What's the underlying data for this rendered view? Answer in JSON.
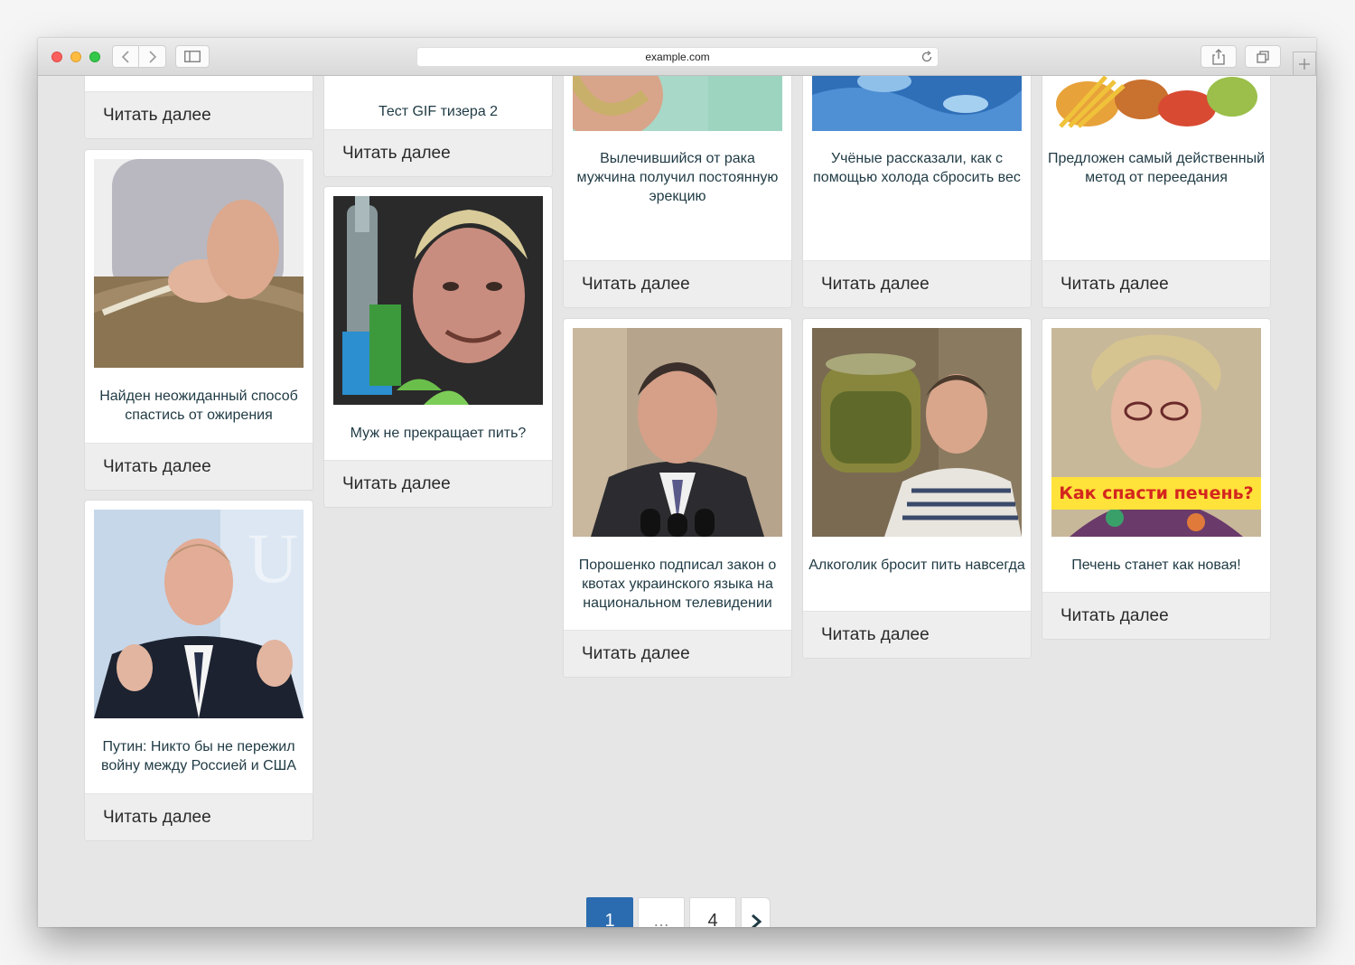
{
  "browser": {
    "url": "example.com"
  },
  "cards": {
    "c1": {
      "title": "",
      "more": "Читать далее"
    },
    "c2": {
      "title": "Найден неожиданный способ спастись от ожирения",
      "more": "Читать далее"
    },
    "c3": {
      "title": "Путин: Никто бы не пережил войну между Россией и США",
      "more": "Читать далее"
    },
    "c4": {
      "title": "Тест GIF тизера 2",
      "more": "Читать далее"
    },
    "c5": {
      "title": "Муж не прекращает пить?",
      "more": "Читать далее"
    },
    "c6": {
      "title": "Вылечившийся от рака мужчина получил постоянную эрекцию",
      "more": "Читать далее"
    },
    "c7": {
      "title": "Порошенко подписал закон о квотах украинского языка на национальном телевидении",
      "more": "Читать далее"
    },
    "c8": {
      "title": "Учёные рассказали, как с помощью холода сбросить вес",
      "more": "Читать далее"
    },
    "c9": {
      "title": "Алкоголик бросит пить навсегда",
      "more": "Читать далее"
    },
    "c10": {
      "title": "Предложен самый действенный метод от переедания",
      "more": "Читать далее"
    },
    "c11": {
      "title": "Печень станет как новая!",
      "more": "Читать далее",
      "banner": "Как спасти печень?"
    }
  },
  "pagination": {
    "current": "1",
    "ellipsis": "…",
    "last": "4",
    "next_icon": "chevron-right-icon"
  },
  "colors": {
    "accent": "#2b6cb0",
    "title_text": "#1f3a44",
    "page_bg": "#e6e6e6"
  }
}
